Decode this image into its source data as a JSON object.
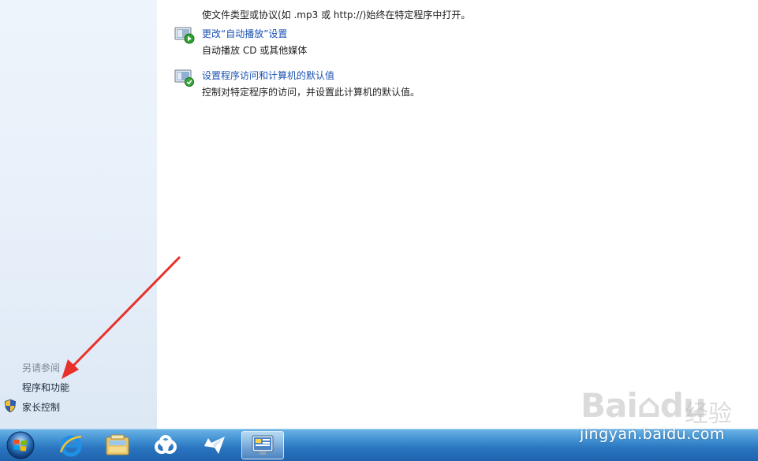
{
  "tasks": [
    {
      "title": "",
      "desc": "使文件类型或协议(如 .mp3 或 http://)始终在特定程序中打开。",
      "icon": "default-programs-icon"
    },
    {
      "title": "更改“自动播放”设置",
      "desc": "自动播放 CD 或其他媒体",
      "icon": "autoplay-icon"
    },
    {
      "title": "设置程序访问和计算机的默认值",
      "desc": "控制对特定程序的访问，并设置此计算机的默认值。",
      "icon": "program-access-icon"
    }
  ],
  "sidebar": {
    "see_also_heading": "另请参阅",
    "links": [
      {
        "label": "程序和功能"
      },
      {
        "label": "家长控制",
        "icon": "uac-shield-icon"
      }
    ]
  },
  "taskbar": {
    "items": [
      "start-orb-icon",
      "ie-icon",
      "explorer-folder-icon",
      "baidu-cloud-icon",
      "bird-app-icon",
      "control-panel-icon"
    ],
    "active_item": "control-panel-icon"
  },
  "watermark": {
    "brand": "Bai du 经验",
    "url": "jingyan.baidu.com"
  },
  "colors": {
    "link": "#1a51b3",
    "sidebar_bg": "#e6eff9",
    "taskbar": "#2a74bf",
    "arrow": "#e8312a"
  }
}
